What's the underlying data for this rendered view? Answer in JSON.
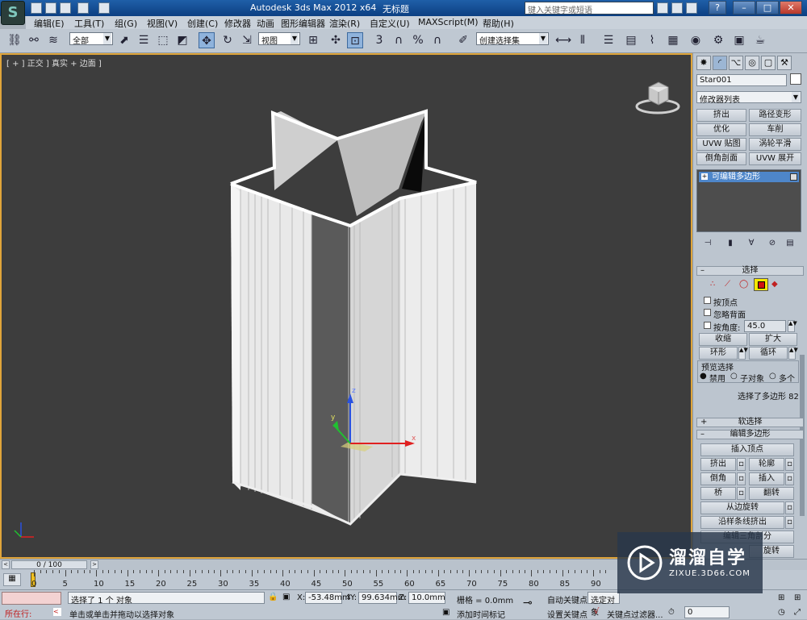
{
  "titlebar": {
    "app_title": "Autodesk 3ds Max  2012 x64",
    "doc_title": "无标题",
    "search_placeholder": "键入关键字或短语",
    "minimize": "–",
    "maximize": "□",
    "close": "✕",
    "help": "?"
  },
  "logo": "S",
  "menu": [
    "编辑(E)",
    "工具(T)",
    "组(G)",
    "视图(V)",
    "创建(C)",
    "修改器",
    "动画",
    "图形编辑器",
    "渲染(R)",
    "自定义(U)",
    "MAXScript(M)",
    "帮助(H)"
  ],
  "toolbar": {
    "selection_filter": "全部",
    "ref_coord": "视图",
    "named_selection": "创建选择集"
  },
  "viewport": {
    "label": "[ + ] 正交 ] 真实 + 边面 ]",
    "axis_x": "x",
    "axis_y": "y",
    "axis_z": "z"
  },
  "command_panel": {
    "object_name": "Star001",
    "modifier_list": "修改器列表",
    "quick_buttons": [
      "挤出",
      "路径变形",
      "优化",
      "车削",
      "UVW 贴图",
      "涡轮平滑",
      "倒角剖面",
      "UVW 展开"
    ],
    "stack_item": "可编辑多边形",
    "selection_rollout": "选择",
    "by_vertex": "按顶点",
    "ignore_backfacing": "忽略背面",
    "by_angle": "按角度:",
    "angle_value": "45.0",
    "shrink": "收缩",
    "grow": "扩大",
    "ring": "环形",
    "loop": "循环",
    "preview_selection": "预览选择",
    "preview_off": "禁用",
    "preview_subobj": "子对象",
    "preview_multi": "多个",
    "selected_info": "选择了多边形 82",
    "soft_selection": "软选择",
    "edit_polygons": "编辑多边形",
    "insert_vertex": "插入顶点",
    "extrude": "挤出",
    "outline": "轮廓",
    "bevel": "倒角",
    "inset": "插入",
    "bridge": "桥",
    "flip": "翻转",
    "hinge_from_edge": "从边旋转",
    "extrude_along_spline": "沿样条线挤出",
    "edit_triangulation": "编辑三角剖分",
    "retriangulate": "旋转"
  },
  "timeline": {
    "frame_counter": "0 / 100",
    "ticks": [
      "0",
      "5",
      "10",
      "15",
      "20",
      "25",
      "30",
      "35",
      "40",
      "45",
      "50",
      "55",
      "60",
      "65",
      "70",
      "75",
      "80",
      "85",
      "90"
    ]
  },
  "status": {
    "maxscript": "所在行:",
    "selection_msg": "选择了 1 个 对象",
    "prompt_msg": "单击或单击并拖动以选择对象",
    "x_label": "X:",
    "x_value": "-53.48mm",
    "y_label": "Y:",
    "y_value": "99.634mm",
    "z_label": "Z:",
    "z_value": "10.0mm",
    "grid": "栅格 = 0.0mm",
    "add_time_tag": "添加时间标记",
    "auto_key": "自动关键点",
    "set_key": "设置关键点",
    "selected_obj": "选定对象",
    "key_filters": "关键点过滤器...",
    "frame": "0"
  },
  "watermark": {
    "brand": "溜溜自学",
    "url": "ZIXUE.3D66.COM"
  }
}
